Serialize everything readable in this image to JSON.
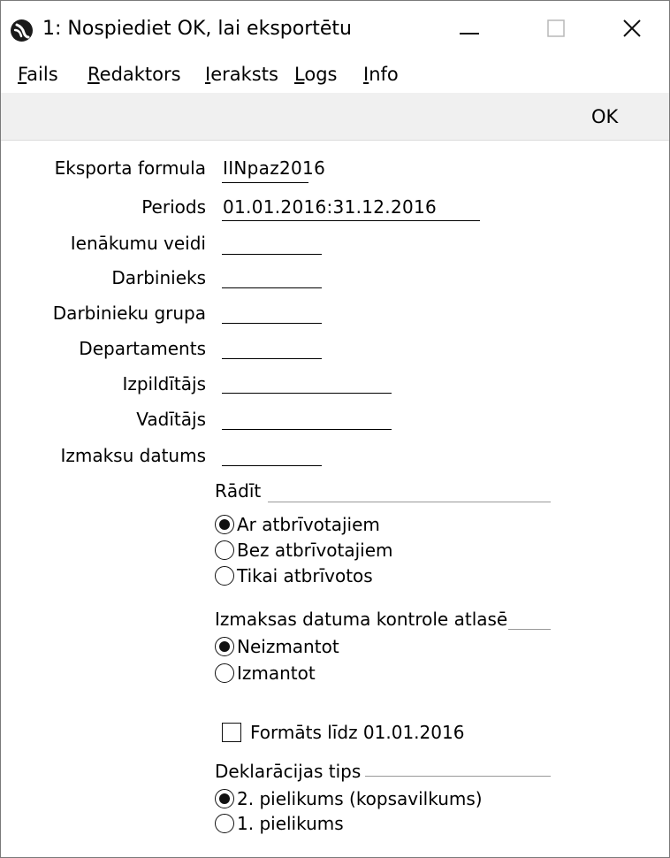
{
  "window": {
    "title": "1: Nospiediet OK, lai eksportētu",
    "controls": {
      "minimize": "—",
      "close": "✕"
    }
  },
  "menu": {
    "items": [
      {
        "accel": "F",
        "rest": "ails"
      },
      {
        "accel": "R",
        "rest": "edaktors"
      },
      {
        "accel": "I",
        "rest": "eraksts"
      },
      {
        "accel": "L",
        "rest": "ogs"
      },
      {
        "accel": "I",
        "rest": "nfo"
      }
    ]
  },
  "toolbar": {
    "ok_label": "OK"
  },
  "form": {
    "fields": [
      {
        "label": "Eksporta formula",
        "value": "IINpaz2016"
      },
      {
        "label": "Periods",
        "value": "01.01.2016:31.12.2016"
      },
      {
        "label": "Ienākumu veidi",
        "value": ""
      },
      {
        "label": "Darbinieks",
        "value": ""
      },
      {
        "label": "Darbinieku grupa",
        "value": ""
      },
      {
        "label": "Departaments",
        "value": ""
      },
      {
        "label": "Izpildītājs",
        "value": ""
      },
      {
        "label": "Vadītājs",
        "value": ""
      },
      {
        "label": "Izmaksu datums",
        "value": ""
      }
    ],
    "radadit": {
      "title": "Rādīt",
      "options": [
        "Ar atbrīvotajiem",
        "Bez atbrīvotajiem",
        "Tikai atbrīvotos"
      ],
      "selected": "Ar atbrīvotajiem"
    },
    "date_control": {
      "title": "Izmaksas datuma kontrole atlasē",
      "options": [
        "Neizmantot",
        "Izmantot"
      ],
      "selected": "Neizmantot"
    },
    "format_checkbox": {
      "label": "Formāts līdz 01.01.2016",
      "checked": false
    },
    "declaration": {
      "title": "Deklarācijas tips",
      "options": [
        "2. pielikums (kopsavilkums)",
        "1. pielikums"
      ],
      "selected": "2. pielikums (kopsavilkums)"
    }
  }
}
